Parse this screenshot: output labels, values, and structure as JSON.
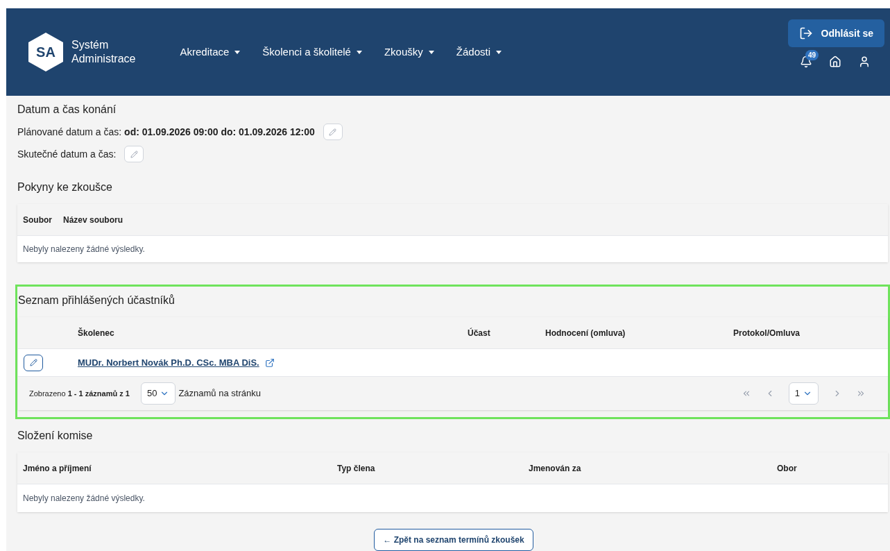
{
  "header": {
    "logo": "SA",
    "brand": [
      "Systém",
      "Administrace"
    ],
    "nav": [
      {
        "label": "Akreditace"
      },
      {
        "label": "Školenci a školitelé"
      },
      {
        "label": "Zkoušky"
      },
      {
        "label": "Žádosti"
      }
    ],
    "logout": "Odhlásit se",
    "notifications": "49"
  },
  "date_section": {
    "title": "Datum a čas konání",
    "planned": "Plánované datum a čas: **od: 01.09.2026 09:00 do: 01.09.2026 12:00**",
    "actual": "Skutečné datum a čas:"
  },
  "instructions": {
    "title": "Pokyny ke zkoušce",
    "columns": [
      "Soubor",
      "Název souboru"
    ],
    "empty": "Nebyly nalezeny žádné výsledky."
  },
  "participants": {
    "title": "Seznam přihlášených účastníků",
    "highlighted": true,
    "columns": [
      "Školenec",
      "Účast",
      "Hodnocení (omluva)",
      "Protokol/Omluva"
    ],
    "rows": [
      {
        "name": "MUDr. Norbert Novák Ph.D. CSc. MBA DiS."
      }
    ],
    "summary": "Zobrazeno **1 - 1 záznamů z 1**",
    "page_size": "50",
    "page_size_label": "Záznamů na stránku",
    "page": "1"
  },
  "committee": {
    "title": "Složení komise",
    "columns": [
      "Jméno a příjmení",
      "Typ člena",
      "Jmenován za",
      "Obor"
    ],
    "empty": "Nebyly nalezeny žádné výsledky."
  },
  "back_button": "← Zpět na seznam termínů zkoušek"
}
